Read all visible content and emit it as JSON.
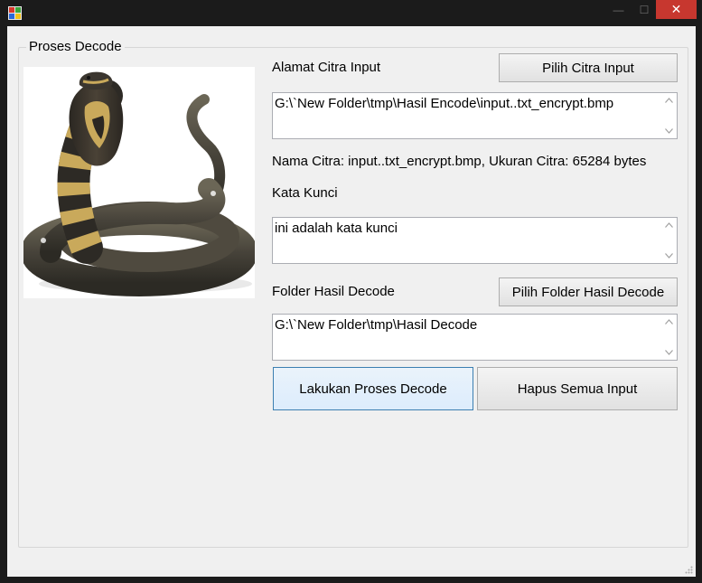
{
  "window": {
    "title": "",
    "controls": {
      "minimize": "—",
      "maximize": "☐",
      "close": "✕"
    }
  },
  "group": {
    "title": "Proses Decode"
  },
  "picture": {
    "icon": "cobra-snake-image"
  },
  "input_image": {
    "label": "Alamat Citra Input",
    "button": "Pilih Citra Input",
    "path": "G:\\`New Folder\\tmp\\Hasil Encode\\input..txt_encrypt.bmp"
  },
  "info": "Nama Citra: input..txt_encrypt.bmp, Ukuran Citra: 65284 bytes",
  "key": {
    "label": "Kata Kunci",
    "value": "ini adalah kata kunci"
  },
  "output_folder": {
    "label": "Folder Hasil Decode",
    "button": "Pilih Folder Hasil Decode",
    "path": "G:\\`New Folder\\tmp\\Hasil Decode"
  },
  "actions": {
    "decode": "Lakukan Proses Decode",
    "clear": "Hapus Semua Input"
  },
  "colors": {
    "close_button": "#c7372f",
    "focus_border": "#3c7fb1",
    "background": "#f0f0f0"
  }
}
